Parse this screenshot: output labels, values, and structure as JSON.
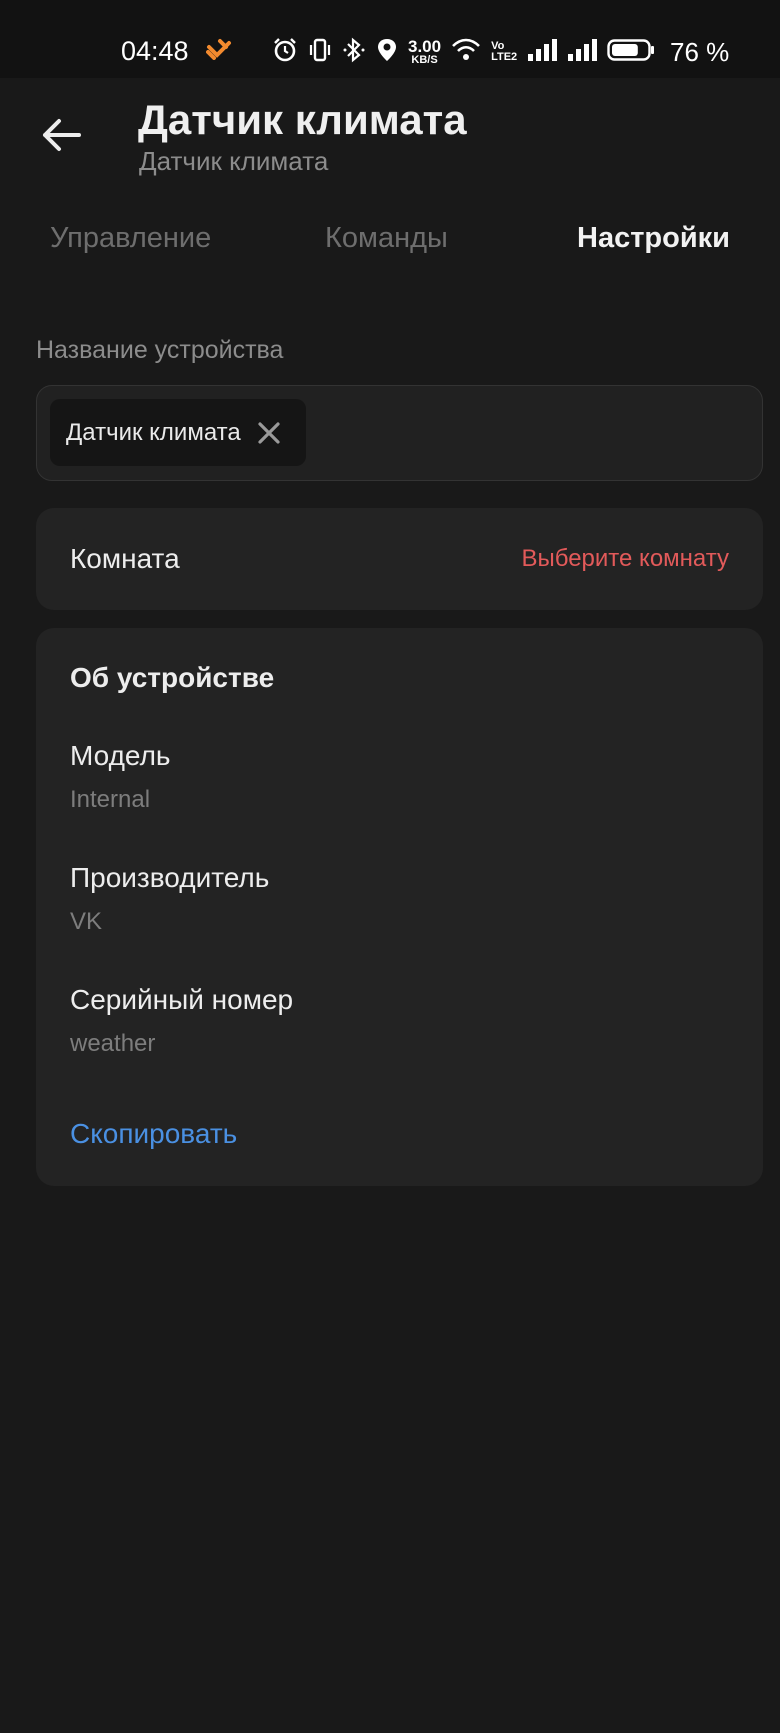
{
  "status_bar": {
    "time": "04:48",
    "net_speed": "3.00",
    "net_speed_unit": "KB/S",
    "volte_top": "Vo",
    "volte_bottom": "LTE2",
    "battery_percent": "76 %",
    "battery_level": 0.76,
    "icons": [
      "app-notification-icon",
      "alarm-icon",
      "vibrate-icon",
      "bluetooth-icon",
      "location-icon",
      "wifi-icon",
      "signal-icon",
      "signal-icon",
      "battery-icon"
    ]
  },
  "header": {
    "title": "Датчик климата",
    "subtitle": "Датчик климата",
    "back_icon": "arrow-left-icon"
  },
  "tabs": [
    {
      "label": "Управление",
      "active": false
    },
    {
      "label": "Команды",
      "active": false
    },
    {
      "label": "Настройки",
      "active": true
    }
  ],
  "device_name": {
    "label": "Название устройства",
    "value": "Датчик климата",
    "clear_icon": "close-icon"
  },
  "room": {
    "label": "Комната",
    "value": "Выберите комнату"
  },
  "about": {
    "title": "Об устройстве",
    "properties": [
      {
        "label": "Модель",
        "value": "Internal"
      },
      {
        "label": "Производитель",
        "value": "VK"
      },
      {
        "label": "Серийный номер",
        "value": "weather"
      }
    ],
    "copy_label": "Скопировать"
  },
  "colors": {
    "background": "#191919",
    "card": "#232323",
    "accent_link": "#4A90E2",
    "accent_warning": "#E25A5A",
    "app_icon": "#F28A2E"
  }
}
